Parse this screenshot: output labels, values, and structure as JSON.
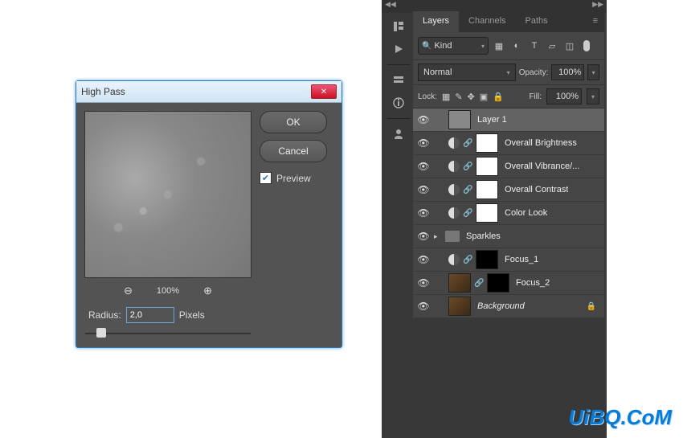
{
  "dialog": {
    "title": "High Pass",
    "ok": "OK",
    "cancel": "Cancel",
    "preview_label": "Preview",
    "preview_checked": true,
    "zoom_percent": "100%",
    "radius_label": "Radius:",
    "radius_value": "2,0",
    "radius_unit": "Pixels"
  },
  "panel": {
    "tabs": {
      "layers": "Layers",
      "channels": "Channels",
      "paths": "Paths"
    },
    "kind_label": "Kind",
    "blend_mode": "Normal",
    "opacity_label": "Opacity:",
    "opacity_value": "100%",
    "lock_label": "Lock:",
    "fill_label": "Fill:",
    "fill_value": "100%",
    "layers": [
      {
        "name": "Layer 1",
        "type": "pixel",
        "selected": true
      },
      {
        "name": "Overall Brightness",
        "type": "adj"
      },
      {
        "name": "Overall Vibrance/...",
        "type": "adj"
      },
      {
        "name": "Overall Contrast",
        "type": "adj"
      },
      {
        "name": "Color Look",
        "type": "adj"
      },
      {
        "name": "Sparkles",
        "type": "group"
      },
      {
        "name": "Focus_1",
        "type": "adj_black"
      },
      {
        "name": "Focus_2",
        "type": "img_mask"
      },
      {
        "name": "Background",
        "type": "bg",
        "locked": true
      }
    ]
  },
  "watermark": "UiBQ.CoM"
}
